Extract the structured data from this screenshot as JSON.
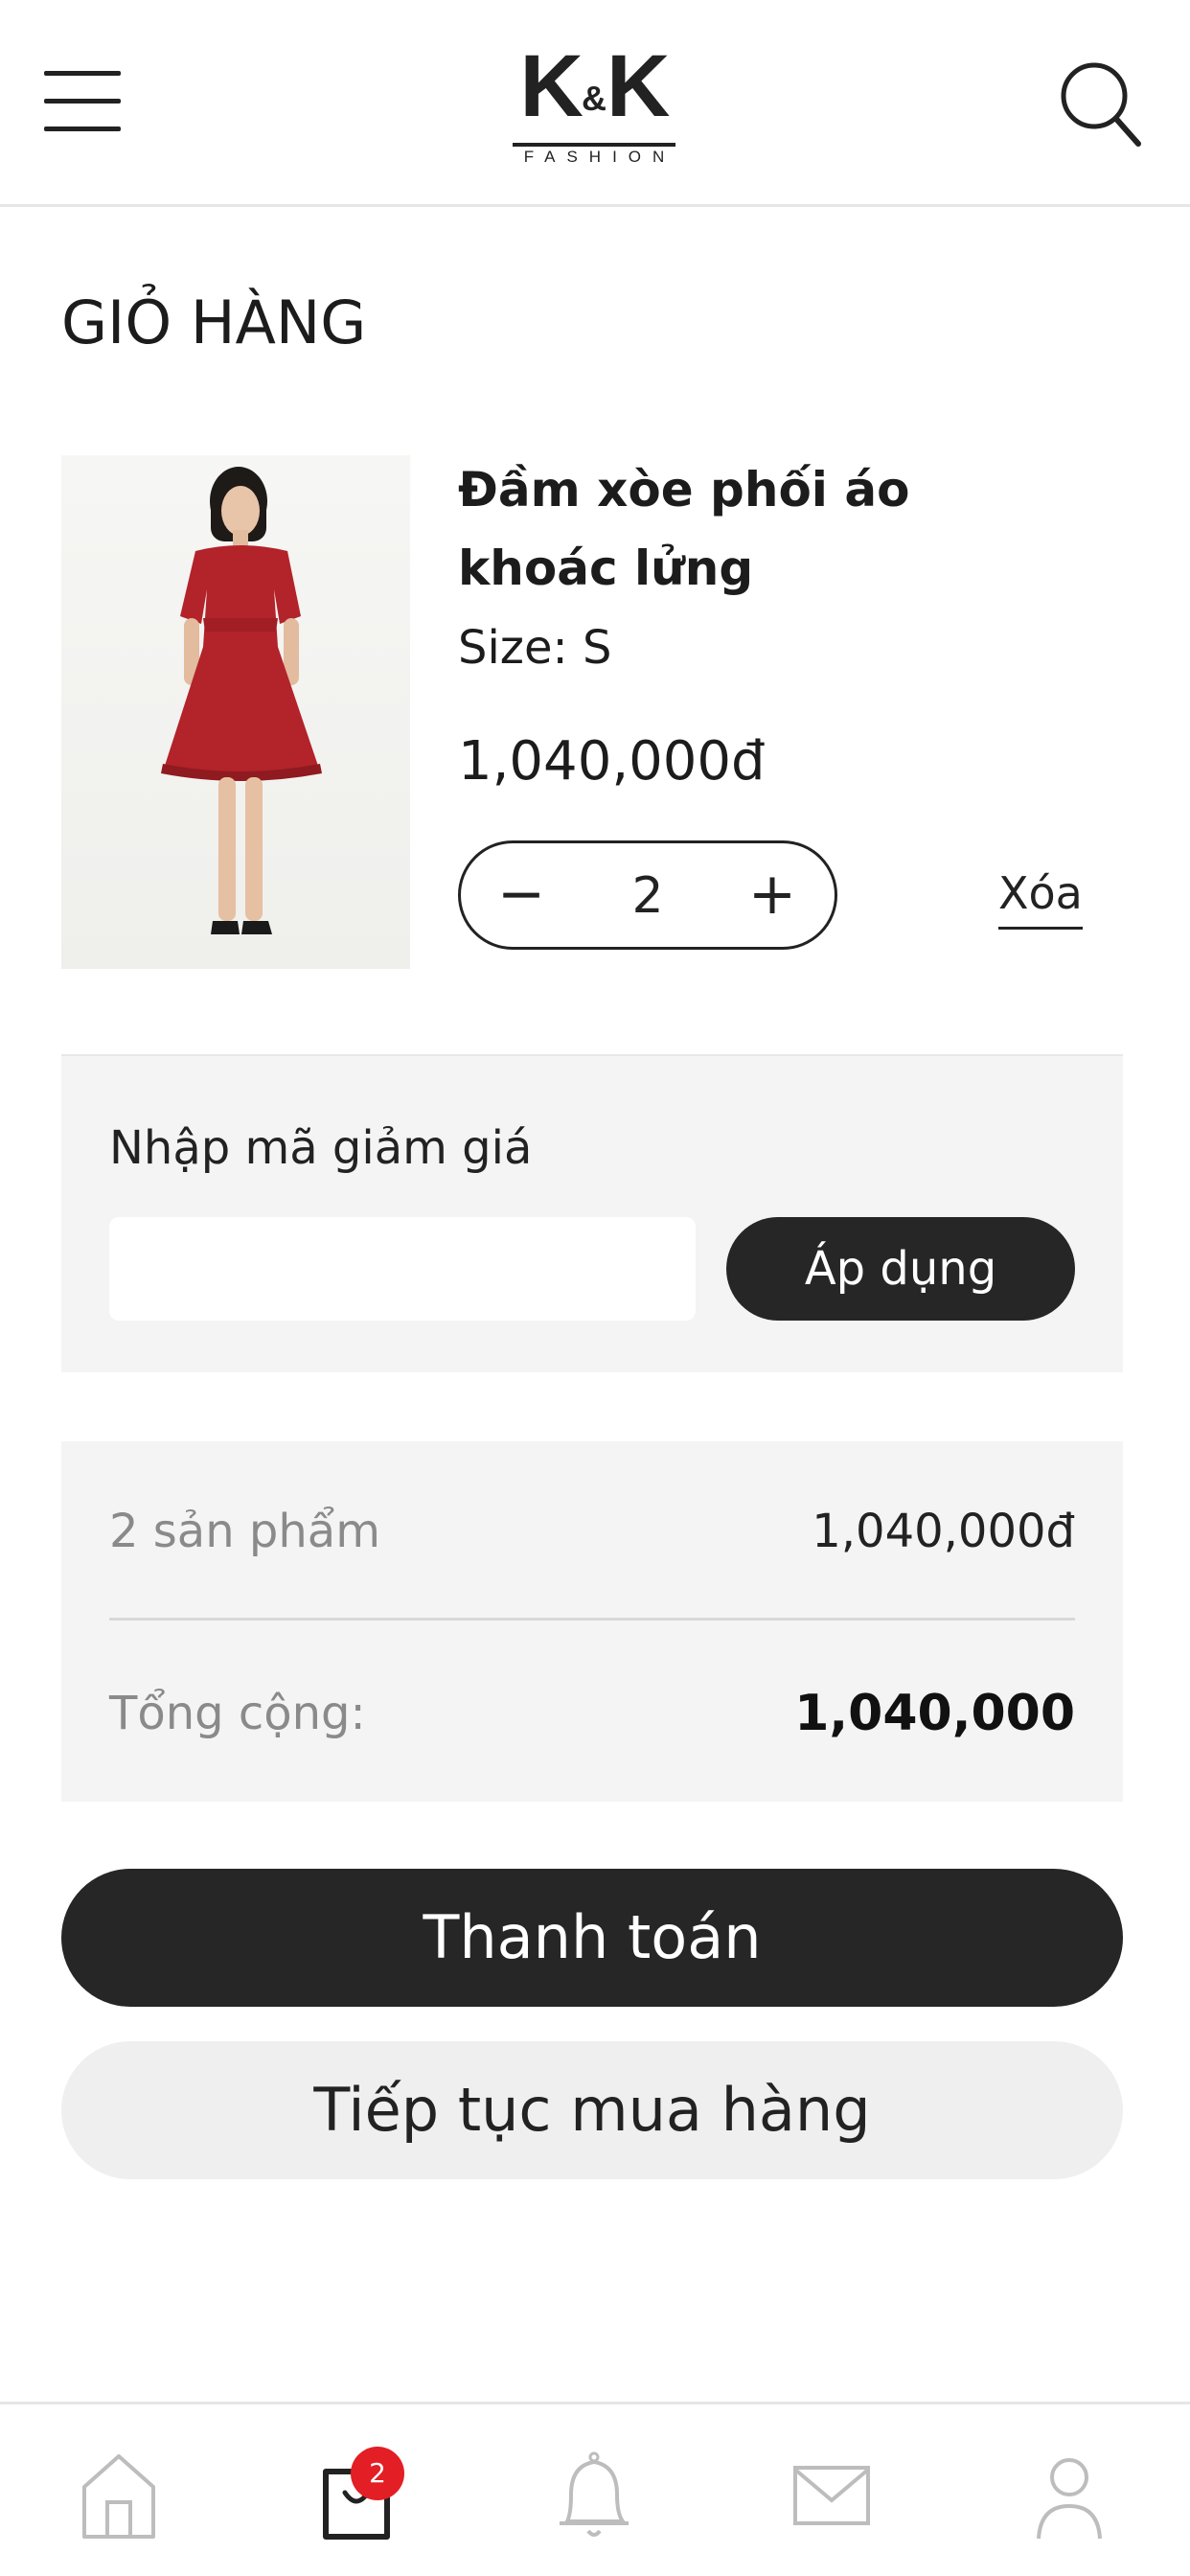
{
  "header": {
    "logo": {
      "main_left": "K",
      "amp": "&",
      "main_right": "K",
      "sub": "FASHION"
    },
    "menu_icon": "hamburger-menu-icon",
    "search_icon": "search-icon"
  },
  "page": {
    "title": "GIỎ HÀNG"
  },
  "cart_item": {
    "name": "Đầm xòe phối áo khoác lửng",
    "size_text": "Size: S",
    "price": "1,040,000đ",
    "quantity": "2",
    "minus_label": "−",
    "plus_label": "+",
    "remove_label": "Xóa",
    "dress_color": "#b3232a"
  },
  "coupon": {
    "label": "Nhập mã giảm giá",
    "input_value": "",
    "input_placeholder": "",
    "apply_label": "Áp dụng"
  },
  "summary": {
    "items_label": "2 sản phẩm",
    "items_value": "1,040,000đ",
    "total_label": "Tổng cộng:",
    "total_value": "1,040,000"
  },
  "actions": {
    "checkout_label": "Thanh toán",
    "continue_label": "Tiếp tục mua hàng"
  },
  "bottom_nav": {
    "items": [
      {
        "icon": "home-icon"
      },
      {
        "icon": "shopping-bag-icon",
        "badge": "2"
      },
      {
        "icon": "bell-icon"
      },
      {
        "icon": "mail-icon"
      },
      {
        "icon": "user-icon"
      }
    ]
  },
  "colors": {
    "primary_dark": "#262626",
    "panel_bg": "#f4f4f4",
    "badge_red": "#e31e24"
  }
}
